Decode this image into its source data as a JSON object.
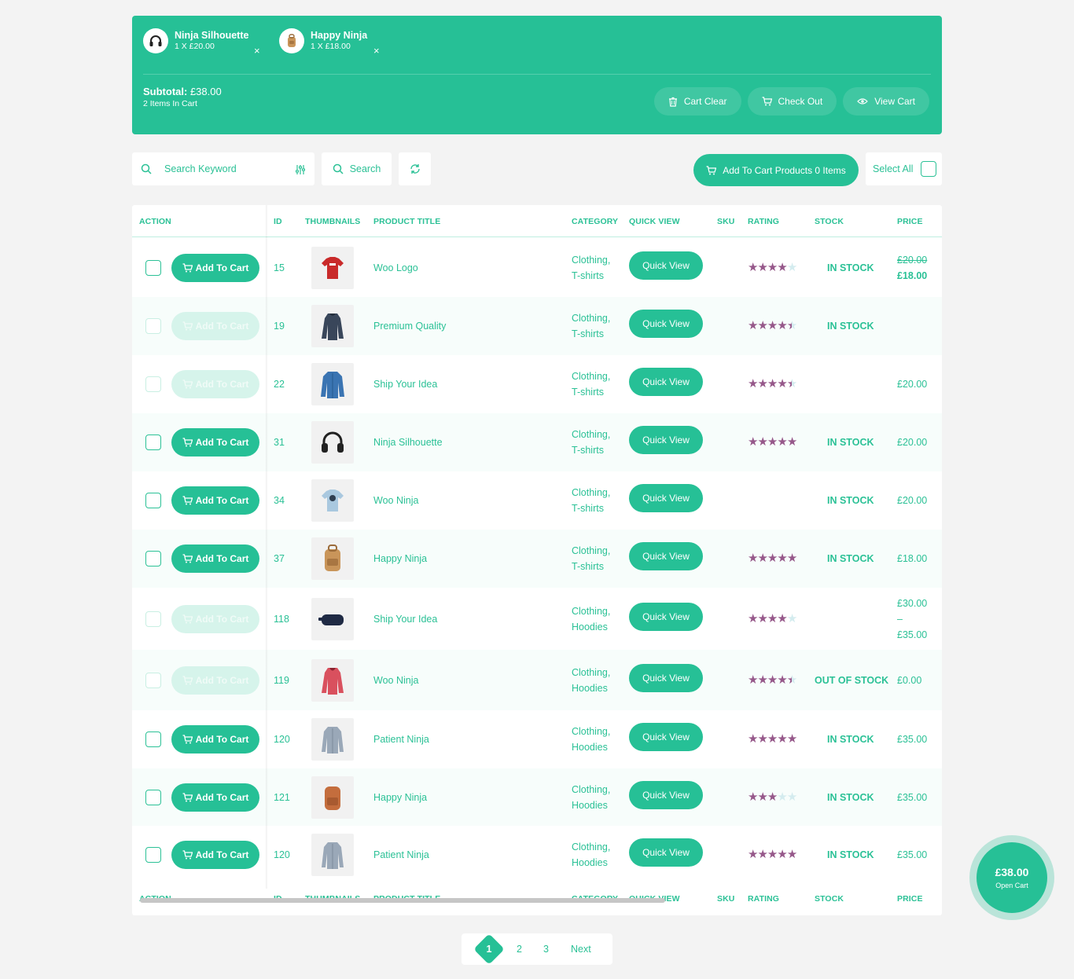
{
  "cart": {
    "items": [
      {
        "name": "Ninja Silhouette",
        "qty": "1 X £20.00",
        "icon": "headphones-icon"
      },
      {
        "name": "Happy Ninja",
        "qty": "1 X £18.00",
        "icon": "backpack-icon"
      }
    ],
    "remove_glyph": "×",
    "subtotal_label": "Subtotal:",
    "subtotal_value": "£38.00",
    "items_in_cart": "2 Items In Cart",
    "buttons": {
      "clear": "Cart Clear",
      "checkout": "Check Out",
      "view": "View Cart"
    }
  },
  "toolbar": {
    "search_placeholder": "Search Keyword",
    "search_label": "Search",
    "add_to_cart_products": "Add To Cart Products 0 Items",
    "select_all": "Select All"
  },
  "table": {
    "headers": {
      "action": "ACTION",
      "id": "ID",
      "thumbnails": "THUMBNAILS",
      "title": "PRODUCT TITLE",
      "category": "CATEGORY",
      "quick_view": "QUICK VIEW",
      "sku": "SKU",
      "rating": "RATING",
      "stock": "STOCK",
      "price": "PRICE"
    },
    "add_to_cart_label": "Add To Cart",
    "quick_view_label": "Quick View",
    "rows": [
      {
        "id": "15",
        "title": "Woo Logo",
        "cat1": "Clothing,",
        "cat2": "T-shirts",
        "rating": 4,
        "stock": "IN STOCK",
        "price_old": "£20.00",
        "price": "£18.00",
        "disabled": false,
        "thumb": "red-tshirt"
      },
      {
        "id": "19",
        "title": "Premium Quality",
        "cat1": "Clothing,",
        "cat2": "T-shirts",
        "rating": 4.5,
        "stock": "IN STOCK",
        "price": "",
        "disabled": true,
        "thumb": "dark-hoodie"
      },
      {
        "id": "22",
        "title": "Ship Your Idea",
        "cat1": "Clothing,",
        "cat2": "T-shirts",
        "rating": 4.5,
        "stock": "",
        "price": "£20.00",
        "disabled": true,
        "thumb": "denim-jacket"
      },
      {
        "id": "31",
        "title": "Ninja Silhouette",
        "cat1": "Clothing,",
        "cat2": "T-shirts",
        "rating": 5,
        "stock": "IN STOCK",
        "price": "£20.00",
        "disabled": false,
        "thumb": "headphones"
      },
      {
        "id": "34",
        "title": "Woo Ninja",
        "cat1": "Clothing,",
        "cat2": "T-shirts",
        "rating": 0,
        "stock": "IN STOCK",
        "price": "£20.00",
        "disabled": false,
        "thumb": "blue-tshirt"
      },
      {
        "id": "37",
        "title": "Happy Ninja",
        "cat1": "Clothing,",
        "cat2": "T-shirts",
        "rating": 5,
        "stock": "IN STOCK",
        "price": "£18.00",
        "disabled": false,
        "thumb": "tan-backpack"
      },
      {
        "id": "118",
        "title": "Ship Your Idea",
        "cat1": "Clothing,",
        "cat2": "Hoodies",
        "rating": 4,
        "stock": "",
        "price_range": [
          "£30.00",
          "–",
          "£35.00"
        ],
        "disabled": true,
        "thumb": "pouch"
      },
      {
        "id": "119",
        "title": "Woo Ninja",
        "cat1": "Clothing,",
        "cat2": "Hoodies",
        "rating": 4.5,
        "stock": "OUT OF STOCK",
        "price": "£0.00",
        "disabled": true,
        "thumb": "red-hoodie"
      },
      {
        "id": "120",
        "title": "Patient Ninja",
        "cat1": "Clothing,",
        "cat2": "Hoodies",
        "rating": 5,
        "stock": "IN STOCK",
        "price": "£35.00",
        "disabled": false,
        "thumb": "grey-coat"
      },
      {
        "id": "121",
        "title": "Happy Ninja",
        "cat1": "Clothing,",
        "cat2": "Hoodies",
        "rating": 3,
        "stock": "IN STOCK",
        "price": "£35.00",
        "disabled": false,
        "thumb": "brown-backpack"
      },
      {
        "id": "120",
        "title": "Patient Ninja",
        "cat1": "Clothing,",
        "cat2": "Hoodies",
        "rating": 5,
        "stock": "IN STOCK",
        "price": "£35.00",
        "disabled": false,
        "thumb": "grey-coat"
      }
    ]
  },
  "pagination": {
    "pages": [
      "1",
      "2",
      "3"
    ],
    "next": "Next",
    "current": "1"
  },
  "floating_cart": {
    "amount": "£38.00",
    "label": "Open Cart"
  },
  "colors": {
    "accent": "#26c096",
    "star": "#96588a",
    "out_of_stock": "#c2284b"
  }
}
